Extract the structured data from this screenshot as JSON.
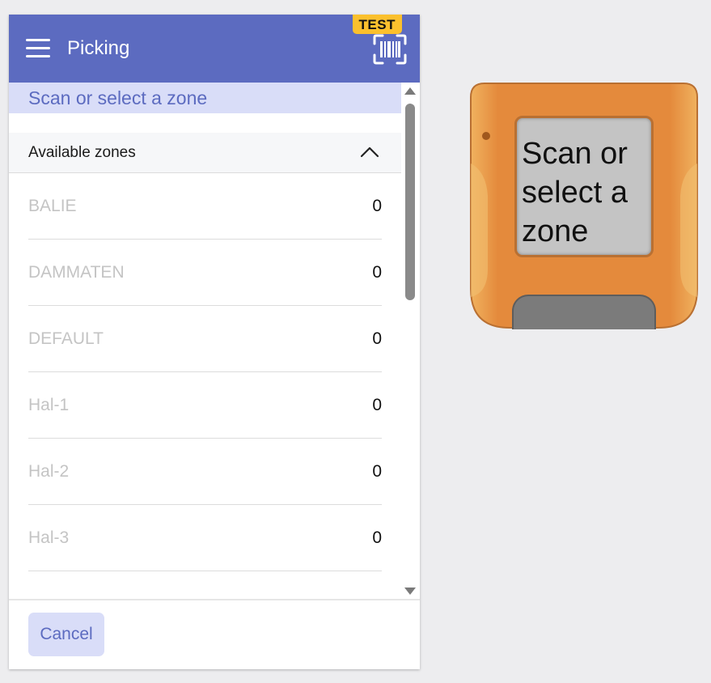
{
  "header": {
    "title": "Picking",
    "badge": "TEST",
    "color": "#5c6bc0"
  },
  "icons": {
    "menu": "menu-icon",
    "scan": "barcode-scan-icon",
    "collapse": "chevron-up-icon"
  },
  "banner": {
    "text": "Scan or select a zone"
  },
  "zones": {
    "title": "Available zones",
    "items": [
      {
        "name": "BALIE",
        "count": "0"
      },
      {
        "name": "DAMMATEN",
        "count": "0"
      },
      {
        "name": "DEFAULT",
        "count": "0"
      },
      {
        "name": "Hal-1",
        "count": "0"
      },
      {
        "name": "Hal-2",
        "count": "0"
      },
      {
        "name": "Hal-3",
        "count": "0"
      }
    ]
  },
  "footer": {
    "cancel_label": "Cancel"
  },
  "scanner": {
    "screen_text": "Scan or select a zone",
    "color": "#e28a3e"
  }
}
